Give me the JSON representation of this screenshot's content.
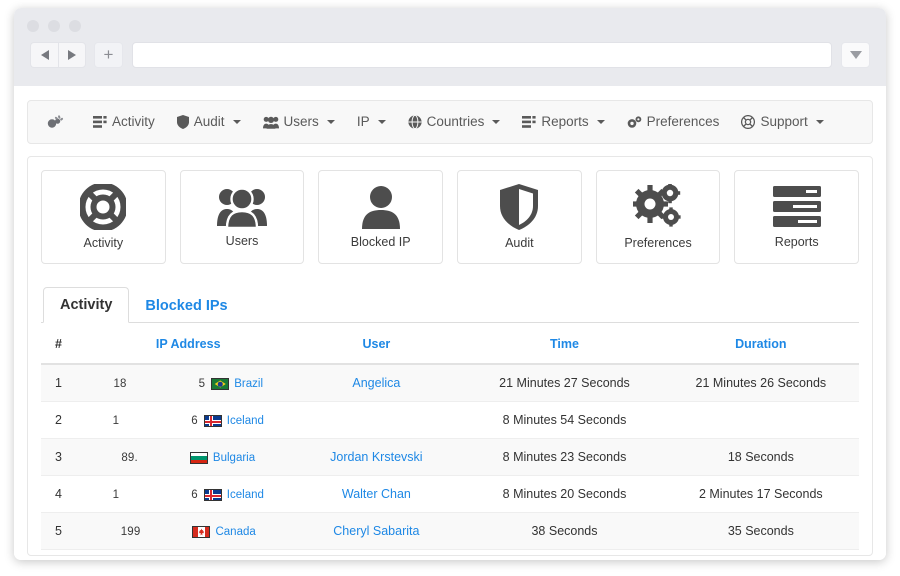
{
  "browser": {
    "back_label": "Back",
    "forward_label": "Forward",
    "new_tab_label": "+",
    "url_value": "",
    "url_placeholder": "",
    "dropdown_label": "Show history"
  },
  "navbar": {
    "brand_label": "Brand",
    "items": [
      {
        "label": "Activity",
        "icon": "list-icon",
        "caret": false
      },
      {
        "label": "Audit",
        "icon": "shield-icon",
        "caret": true
      },
      {
        "label": "Users",
        "icon": "users-icon",
        "caret": true
      },
      {
        "label": "IP",
        "icon": "none",
        "caret": true
      },
      {
        "label": "Countries",
        "icon": "globe-icon",
        "caret": true
      },
      {
        "label": "Reports",
        "icon": "report-icon",
        "caret": true
      },
      {
        "label": "Preferences",
        "icon": "gears-icon",
        "caret": false
      },
      {
        "label": "Support",
        "icon": "lifebuoy-icon",
        "caret": true
      }
    ]
  },
  "cards": [
    {
      "label": "Activity",
      "icon": "lifebuoy-icon"
    },
    {
      "label": "Users",
      "icon": "users-icon"
    },
    {
      "label": "Blocked IP",
      "icon": "user-icon"
    },
    {
      "label": "Audit",
      "icon": "shield-icon"
    },
    {
      "label": "Preferences",
      "icon": "gears-icon"
    },
    {
      "label": "Reports",
      "icon": "server-icon"
    }
  ],
  "tabs": [
    {
      "label": "Activity",
      "active": true
    },
    {
      "label": "Blocked IPs",
      "active": false
    }
  ],
  "table": {
    "columns": [
      "#",
      "IP Address",
      "User",
      "Time",
      "Duration"
    ],
    "rows": [
      {
        "num": "1",
        "ip_prefix": "18",
        "ip_suffix": "5",
        "ip_redacted": true,
        "country": "Brazil",
        "flag": "br",
        "user": "Angelica",
        "time": "21 Minutes 27 Seconds",
        "duration": "21 Minutes 26 Seconds"
      },
      {
        "num": "2",
        "ip_prefix": "1",
        "ip_suffix": "6",
        "ip_redacted": true,
        "country": "Iceland",
        "flag": "is",
        "user": "",
        "time": "8 Minutes 54 Seconds",
        "duration": ""
      },
      {
        "num": "3",
        "ip_prefix": "89.",
        "ip_suffix": "",
        "ip_redacted": true,
        "country": "Bulgaria",
        "flag": "bg",
        "user": "Jordan Krstevski",
        "time": "8 Minutes 23 Seconds",
        "duration": "18 Seconds"
      },
      {
        "num": "4",
        "ip_prefix": "1",
        "ip_suffix": "6",
        "ip_redacted": true,
        "country": "Iceland",
        "flag": "is",
        "user": "Walter Chan",
        "time": "8 Minutes 20 Seconds",
        "duration": "2 Minutes 17 Seconds"
      },
      {
        "num": "5",
        "ip_prefix": "199",
        "ip_suffix": "",
        "ip_redacted": true,
        "country": "Canada",
        "flag": "ca",
        "user": "Cheryl Sabarita",
        "time": "38 Seconds",
        "duration": "35 Seconds"
      }
    ]
  },
  "colors": {
    "link": "#1e88e5",
    "icon_dark": "#4d4d4d",
    "navbar_bg": "#f8f8f8",
    "text": "#333333"
  }
}
